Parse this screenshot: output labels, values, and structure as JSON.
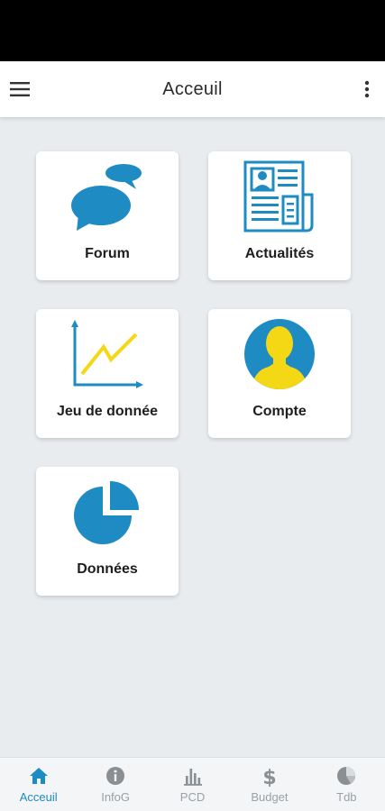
{
  "colors": {
    "accent": "#1e8bc3",
    "yellow": "#f4d815",
    "inactive": "#9aa0a6"
  },
  "header": {
    "title": "Acceuil",
    "menu_icon": "hamburger-menu-icon",
    "more_icon": "more-vert-icon"
  },
  "cards": [
    {
      "label": "Forum",
      "icon": "chat-bubbles-icon"
    },
    {
      "label": "Actualités",
      "icon": "newspaper-icon"
    },
    {
      "label": "Jeu de donnée",
      "icon": "line-chart-icon"
    },
    {
      "label": "Compte",
      "icon": "user-avatar-icon"
    },
    {
      "label": "Données",
      "icon": "pie-chart-icon"
    }
  ],
  "bottom_nav": {
    "active": "Acceuil",
    "items": [
      {
        "label": "Acceuil",
        "icon": "home-icon"
      },
      {
        "label": "InfoG",
        "icon": "info-icon"
      },
      {
        "label": "PCD",
        "icon": "bar-chart-icon"
      },
      {
        "label": "Budget",
        "icon": "dollar-icon"
      },
      {
        "label": "Tdb",
        "icon": "pie-icon"
      }
    ]
  }
}
